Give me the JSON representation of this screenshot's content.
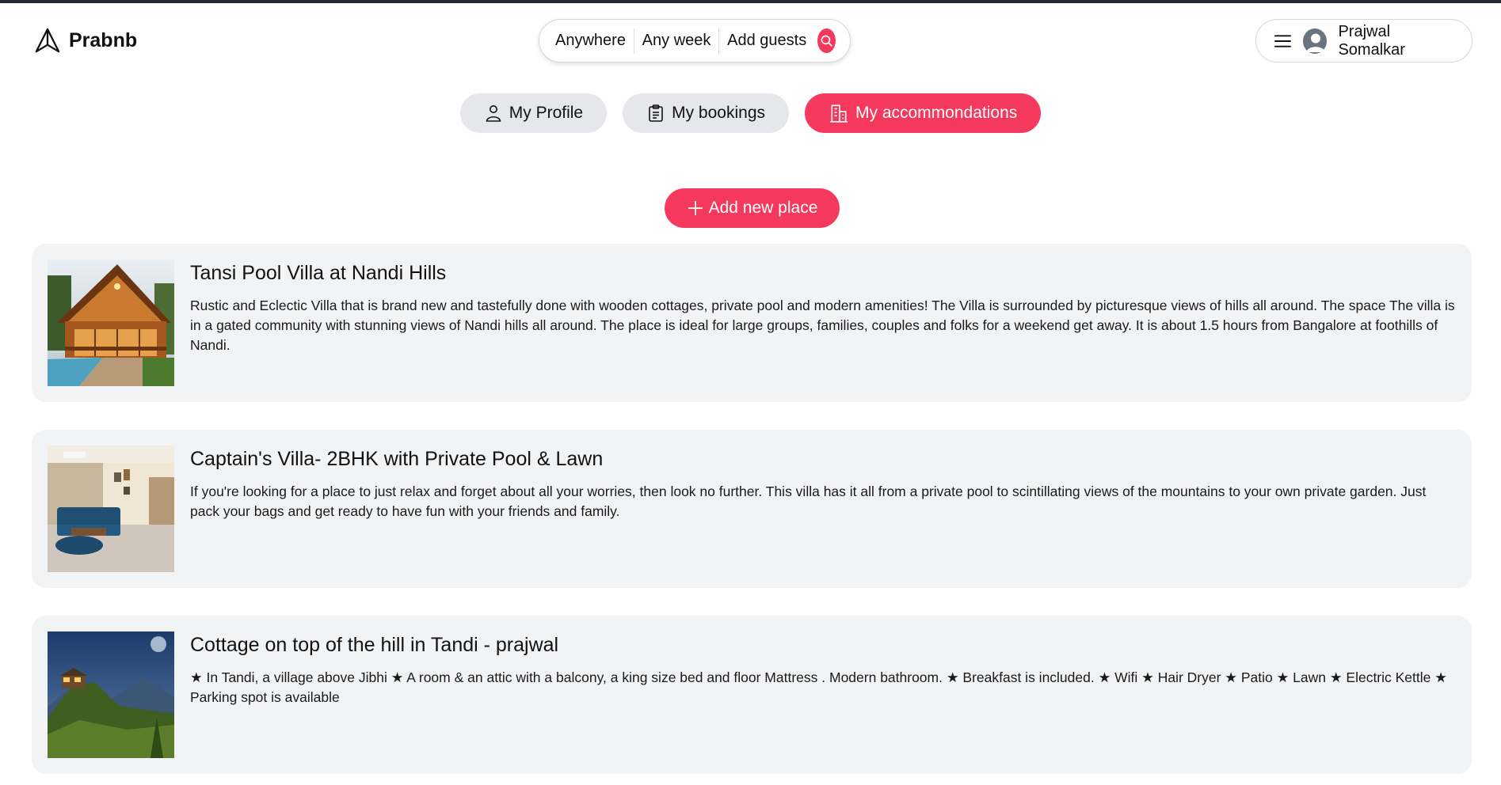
{
  "app": {
    "name": "Prabnb"
  },
  "search": {
    "where": "Anywhere",
    "when": "Any week",
    "guests": "Add guests"
  },
  "user": {
    "name": "Prajwal Somalkar"
  },
  "tabs": [
    {
      "label": "My Profile",
      "icon": "person-icon",
      "active": false
    },
    {
      "label": "My bookings",
      "icon": "clipboard-icon",
      "active": false
    },
    {
      "label": "My accommondations",
      "icon": "building-icon",
      "active": true
    }
  ],
  "add_place": {
    "label": "Add new place"
  },
  "places": [
    {
      "title": "Tansi Pool Villa at Nandi Hills",
      "description": "Rustic and Eclectic Villa that is brand new and tastefully done with wooden cottages, private pool and modern amenities! The Villa is surrounded by picturesque views of hills all around. The space The villa is in a gated community with stunning views of Nandi hills all around. The place is ideal for large groups, families, couples and folks for a weekend get away. It is about 1.5 hours from Bangalore at foothills of Nandi."
    },
    {
      "title": "Captain's Villa- 2BHK with Private Pool & Lawn",
      "description": "If you're looking for a place to just relax and forget about all your worries, then look no further. This villa has it all from a private pool to scintillating views of the mountains to your own private garden. Just pack your bags and get ready to have fun with your friends and family."
    },
    {
      "title": "Cottage on top of the hill in Tandi - prajwal",
      "description": "★ In Tandi, a village above Jibhi ★ A room & an attic with a balcony, a king size bed and floor Mattress . Modern bathroom. ★ Breakfast is included. ★ Wifi ★ Hair Dryer ★ Patio ★ Lawn ★ Electric Kettle ★ Parking spot is available"
    }
  ],
  "colors": {
    "accent": "#f5385d",
    "tab_bg": "#e5e7eb",
    "card_bg": "#f2f3f5"
  }
}
